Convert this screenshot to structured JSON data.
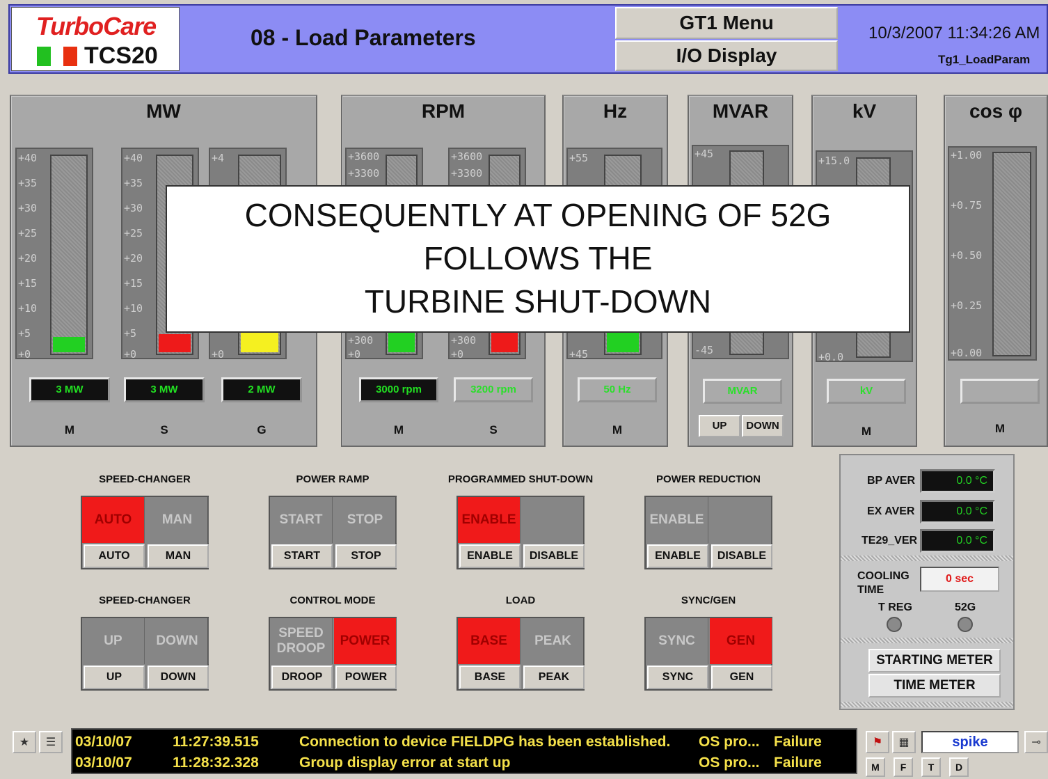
{
  "header": {
    "logo_brand": "TurboCare",
    "logo_product": "TCS20",
    "page_title": "08 - Load Parameters",
    "menu_button": "GT1 Menu",
    "io_button": "I/O Display",
    "datetime": "10/3/2007 11:34:26 AM",
    "screen_id": "Tg1_LoadParam"
  },
  "panels": {
    "mw": {
      "title": "MW",
      "ticks": [
        "+40",
        "+35",
        "+30",
        "+25",
        "+20",
        "+15",
        "+10",
        "+5",
        "+0"
      ],
      "gauges": [
        {
          "readout": "3 MW",
          "label": "M",
          "color": "#22d022",
          "level": 0.08
        },
        {
          "readout": "3 MW",
          "label": "S",
          "color": "#ee1a1a",
          "level": 0.08
        },
        {
          "readout": "2 MW",
          "label": "G",
          "color": "#f5f020",
          "level": 0.06
        }
      ],
      "g_tick_top": "+4"
    },
    "rpm": {
      "title": "RPM",
      "ticks": [
        "+3600",
        "+3300",
        "+300",
        "+0"
      ],
      "gauges": [
        {
          "readout": "3000 rpm",
          "label": "M",
          "color": "#22d022"
        },
        {
          "readout": "3200 rpm",
          "label": "S",
          "color": "#ee1a1a"
        }
      ]
    },
    "hz": {
      "title": "Hz",
      "ticks": [
        "+55",
        "+45"
      ],
      "readout": "50 Hz",
      "label": "M",
      "color": "#22d022"
    },
    "mvar": {
      "title": "MVAR",
      "ticks": [
        "+45",
        "-45"
      ],
      "readout": "MVAR",
      "up": "UP",
      "down": "DOWN"
    },
    "kv": {
      "title": "kV",
      "ticks": [
        "+15.0",
        "+0.0"
      ],
      "readout": "kV",
      "label": "M"
    },
    "cos": {
      "title": "cos φ",
      "ticks": [
        "+1.00",
        "+0.75",
        "+0.50",
        "+0.25",
        "+0.00"
      ],
      "label": "M"
    }
  },
  "controls": [
    {
      "title": "SPEED-CHANGER",
      "ind": [
        "AUTO",
        "MAN"
      ],
      "on": 0,
      "btns": [
        "AUTO",
        "MAN"
      ]
    },
    {
      "title": "POWER RAMP",
      "ind": [
        "START",
        "STOP"
      ],
      "on": -1,
      "btns": [
        "START",
        "STOP"
      ]
    },
    {
      "title": "PROGRAMMED SHUT-DOWN",
      "ind": [
        "ENABLE",
        ""
      ],
      "on": 0,
      "btns": [
        "ENABLE",
        "DISABLE"
      ]
    },
    {
      "title": "POWER REDUCTION",
      "ind": [
        "ENABLE",
        ""
      ],
      "on": -1,
      "btns": [
        "ENABLE",
        "DISABLE"
      ]
    },
    {
      "title": "SPEED-CHANGER",
      "ind": [
        "UP",
        "DOWN"
      ],
      "on": -1,
      "btns": [
        "UP",
        "DOWN"
      ]
    },
    {
      "title": "CONTROL MODE",
      "ind": [
        "SPEED DROOP",
        "POWER"
      ],
      "on": 1,
      "btns": [
        "DROOP",
        "POWER"
      ]
    },
    {
      "title": "LOAD",
      "ind": [
        "BASE",
        "PEAK"
      ],
      "on": 0,
      "btns": [
        "BASE",
        "PEAK"
      ]
    },
    {
      "title": "SYNC/GEN",
      "ind": [
        "SYNC",
        "GEN"
      ],
      "on": 1,
      "btns": [
        "SYNC",
        "GEN"
      ]
    }
  ],
  "status": {
    "bp_label": "BP AVER",
    "bp_value": "0.0 °C",
    "ex_label": "EX AVER",
    "ex_value": "0.0 °C",
    "te_label": "TE29_VER",
    "te_value": "0.0 °C",
    "cooling_label": "COOLING TIME",
    "cooling_value": "0 sec",
    "treg_label": "T REG",
    "g52_label": "52G",
    "starting_meter": "STARTING METER",
    "time_meter": "TIME METER"
  },
  "overlay": {
    "line1": "CONSEQUENTLY AT OPENING OF 52G",
    "line2": "FOLLOWS THE",
    "line3": "TURBINE SHUT-DOWN"
  },
  "messages": [
    {
      "date": "03/10/07",
      "time": "11:27:39.515",
      "text": "Connection to device FIELDPG has been established.",
      "source": "OS pro...",
      "status": "Failure"
    },
    {
      "date": "03/10/07",
      "time": "11:28:32.328",
      "text": "Group display error at start up",
      "source": "OS pro...",
      "status": "Failure"
    }
  ],
  "footer": {
    "user": "spike",
    "keys": [
      "M",
      "F",
      "T",
      "D"
    ]
  }
}
